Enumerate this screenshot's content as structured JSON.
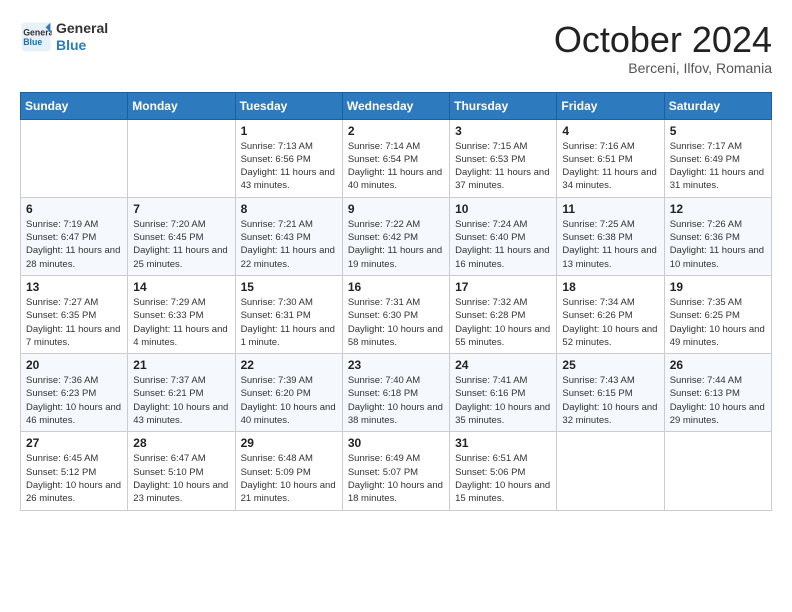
{
  "header": {
    "logo_line1": "General",
    "logo_line2": "Blue",
    "month_title": "October 2024",
    "subtitle": "Berceni, Ilfov, Romania"
  },
  "weekdays": [
    "Sunday",
    "Monday",
    "Tuesday",
    "Wednesday",
    "Thursday",
    "Friday",
    "Saturday"
  ],
  "weeks": [
    [
      {
        "day": "",
        "sunrise": "",
        "sunset": "",
        "daylight": ""
      },
      {
        "day": "",
        "sunrise": "",
        "sunset": "",
        "daylight": ""
      },
      {
        "day": "1",
        "sunrise": "Sunrise: 7:13 AM",
        "sunset": "Sunset: 6:56 PM",
        "daylight": "Daylight: 11 hours and 43 minutes."
      },
      {
        "day": "2",
        "sunrise": "Sunrise: 7:14 AM",
        "sunset": "Sunset: 6:54 PM",
        "daylight": "Daylight: 11 hours and 40 minutes."
      },
      {
        "day": "3",
        "sunrise": "Sunrise: 7:15 AM",
        "sunset": "Sunset: 6:53 PM",
        "daylight": "Daylight: 11 hours and 37 minutes."
      },
      {
        "day": "4",
        "sunrise": "Sunrise: 7:16 AM",
        "sunset": "Sunset: 6:51 PM",
        "daylight": "Daylight: 11 hours and 34 minutes."
      },
      {
        "day": "5",
        "sunrise": "Sunrise: 7:17 AM",
        "sunset": "Sunset: 6:49 PM",
        "daylight": "Daylight: 11 hours and 31 minutes."
      }
    ],
    [
      {
        "day": "6",
        "sunrise": "Sunrise: 7:19 AM",
        "sunset": "Sunset: 6:47 PM",
        "daylight": "Daylight: 11 hours and 28 minutes."
      },
      {
        "day": "7",
        "sunrise": "Sunrise: 7:20 AM",
        "sunset": "Sunset: 6:45 PM",
        "daylight": "Daylight: 11 hours and 25 minutes."
      },
      {
        "day": "8",
        "sunrise": "Sunrise: 7:21 AM",
        "sunset": "Sunset: 6:43 PM",
        "daylight": "Daylight: 11 hours and 22 minutes."
      },
      {
        "day": "9",
        "sunrise": "Sunrise: 7:22 AM",
        "sunset": "Sunset: 6:42 PM",
        "daylight": "Daylight: 11 hours and 19 minutes."
      },
      {
        "day": "10",
        "sunrise": "Sunrise: 7:24 AM",
        "sunset": "Sunset: 6:40 PM",
        "daylight": "Daylight: 11 hours and 16 minutes."
      },
      {
        "day": "11",
        "sunrise": "Sunrise: 7:25 AM",
        "sunset": "Sunset: 6:38 PM",
        "daylight": "Daylight: 11 hours and 13 minutes."
      },
      {
        "day": "12",
        "sunrise": "Sunrise: 7:26 AM",
        "sunset": "Sunset: 6:36 PM",
        "daylight": "Daylight: 11 hours and 10 minutes."
      }
    ],
    [
      {
        "day": "13",
        "sunrise": "Sunrise: 7:27 AM",
        "sunset": "Sunset: 6:35 PM",
        "daylight": "Daylight: 11 hours and 7 minutes."
      },
      {
        "day": "14",
        "sunrise": "Sunrise: 7:29 AM",
        "sunset": "Sunset: 6:33 PM",
        "daylight": "Daylight: 11 hours and 4 minutes."
      },
      {
        "day": "15",
        "sunrise": "Sunrise: 7:30 AM",
        "sunset": "Sunset: 6:31 PM",
        "daylight": "Daylight: 11 hours and 1 minute."
      },
      {
        "day": "16",
        "sunrise": "Sunrise: 7:31 AM",
        "sunset": "Sunset: 6:30 PM",
        "daylight": "Daylight: 10 hours and 58 minutes."
      },
      {
        "day": "17",
        "sunrise": "Sunrise: 7:32 AM",
        "sunset": "Sunset: 6:28 PM",
        "daylight": "Daylight: 10 hours and 55 minutes."
      },
      {
        "day": "18",
        "sunrise": "Sunrise: 7:34 AM",
        "sunset": "Sunset: 6:26 PM",
        "daylight": "Daylight: 10 hours and 52 minutes."
      },
      {
        "day": "19",
        "sunrise": "Sunrise: 7:35 AM",
        "sunset": "Sunset: 6:25 PM",
        "daylight": "Daylight: 10 hours and 49 minutes."
      }
    ],
    [
      {
        "day": "20",
        "sunrise": "Sunrise: 7:36 AM",
        "sunset": "Sunset: 6:23 PM",
        "daylight": "Daylight: 10 hours and 46 minutes."
      },
      {
        "day": "21",
        "sunrise": "Sunrise: 7:37 AM",
        "sunset": "Sunset: 6:21 PM",
        "daylight": "Daylight: 10 hours and 43 minutes."
      },
      {
        "day": "22",
        "sunrise": "Sunrise: 7:39 AM",
        "sunset": "Sunset: 6:20 PM",
        "daylight": "Daylight: 10 hours and 40 minutes."
      },
      {
        "day": "23",
        "sunrise": "Sunrise: 7:40 AM",
        "sunset": "Sunset: 6:18 PM",
        "daylight": "Daylight: 10 hours and 38 minutes."
      },
      {
        "day": "24",
        "sunrise": "Sunrise: 7:41 AM",
        "sunset": "Sunset: 6:16 PM",
        "daylight": "Daylight: 10 hours and 35 minutes."
      },
      {
        "day": "25",
        "sunrise": "Sunrise: 7:43 AM",
        "sunset": "Sunset: 6:15 PM",
        "daylight": "Daylight: 10 hours and 32 minutes."
      },
      {
        "day": "26",
        "sunrise": "Sunrise: 7:44 AM",
        "sunset": "Sunset: 6:13 PM",
        "daylight": "Daylight: 10 hours and 29 minutes."
      }
    ],
    [
      {
        "day": "27",
        "sunrise": "Sunrise: 6:45 AM",
        "sunset": "Sunset: 5:12 PM",
        "daylight": "Daylight: 10 hours and 26 minutes."
      },
      {
        "day": "28",
        "sunrise": "Sunrise: 6:47 AM",
        "sunset": "Sunset: 5:10 PM",
        "daylight": "Daylight: 10 hours and 23 minutes."
      },
      {
        "day": "29",
        "sunrise": "Sunrise: 6:48 AM",
        "sunset": "Sunset: 5:09 PM",
        "daylight": "Daylight: 10 hours and 21 minutes."
      },
      {
        "day": "30",
        "sunrise": "Sunrise: 6:49 AM",
        "sunset": "Sunset: 5:07 PM",
        "daylight": "Daylight: 10 hours and 18 minutes."
      },
      {
        "day": "31",
        "sunrise": "Sunrise: 6:51 AM",
        "sunset": "Sunset: 5:06 PM",
        "daylight": "Daylight: 10 hours and 15 minutes."
      },
      {
        "day": "",
        "sunrise": "",
        "sunset": "",
        "daylight": ""
      },
      {
        "day": "",
        "sunrise": "",
        "sunset": "",
        "daylight": ""
      }
    ]
  ]
}
